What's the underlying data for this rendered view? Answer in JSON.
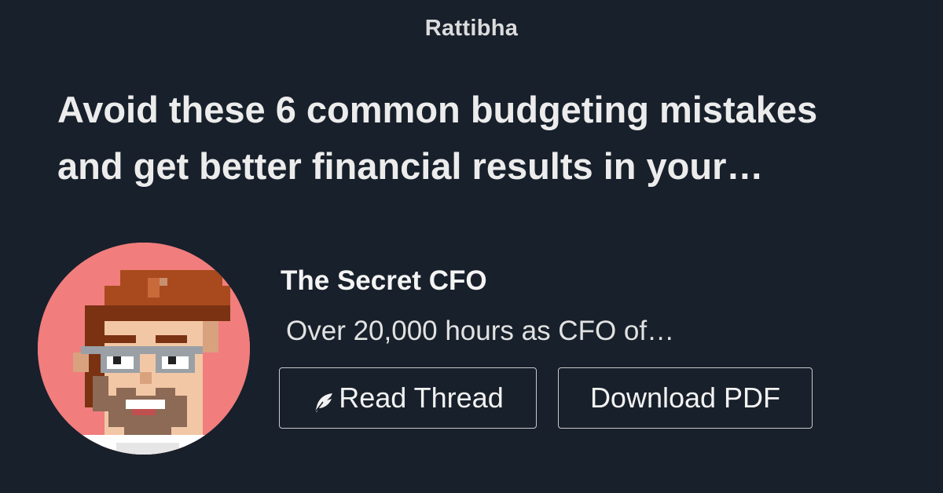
{
  "site": {
    "name": "Rattibha"
  },
  "thread": {
    "title": "Avoid these 6 common budgeting mistakes and get better financial results in your…"
  },
  "author": {
    "name": "The Secret CFO",
    "bio": "Over 20,000 hours as CFO of…",
    "avatar_background": "#f17d7d"
  },
  "actions": {
    "read_thread_label": "Read Thread",
    "read_thread_icon": "feather-icon",
    "download_pdf_label": "Download PDF"
  },
  "colors": {
    "background": "#18202b",
    "text": "#ececec",
    "button_border": "#c9c9c9"
  }
}
